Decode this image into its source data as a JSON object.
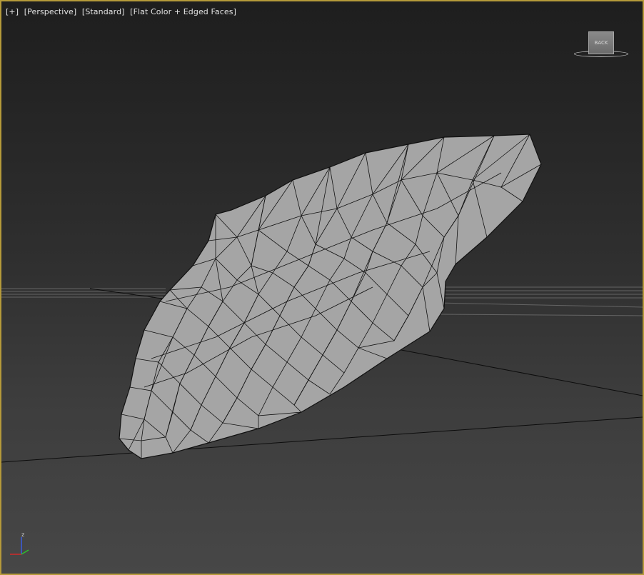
{
  "viewport": {
    "labels": [
      "[+]",
      "[Perspective]",
      "[Standard]",
      "[Flat Color + Edged Faces]"
    ],
    "viewcube_label": "BACK",
    "axis_label_z": "z",
    "border_color": "#b59a3a",
    "mesh_fill": "#a5a5a5",
    "mesh_edge": "#111111"
  }
}
